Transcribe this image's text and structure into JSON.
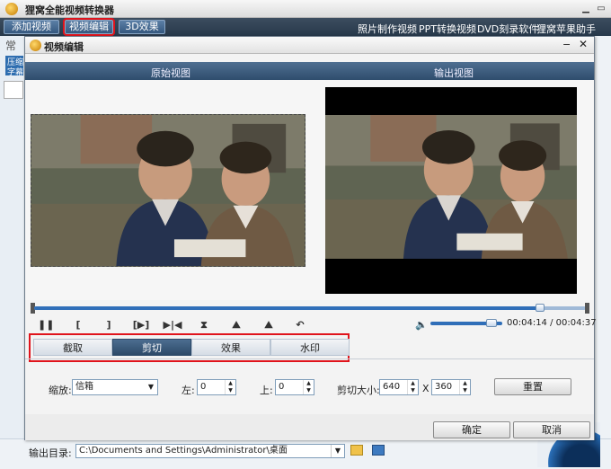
{
  "app": {
    "title": "狸窝全能视频转换器",
    "toolbar": {
      "add_video": "添加视频",
      "video_edit": "视频编辑",
      "effect_3d": "3D效果"
    },
    "links": [
      "照片制作视频",
      "PPT转换视频",
      "DVD刻录软件",
      "狸窝苹果助手"
    ],
    "bg_tab": "常",
    "bg_text": [
      "压缩",
      "字幕"
    ],
    "output_label": "输出目录:",
    "output_path": "C:\\Documents and Settings\\Administrator\\桌面"
  },
  "dialog": {
    "title": "视频编辑",
    "min": "−",
    "close": "✕",
    "original_view": "原始视图",
    "output_view": "输出视图",
    "time_current": "00:04:14",
    "time_total": "00:04:37",
    "time_text": "00:04:14 / 00:04:37",
    "seek_fraction": 0.917,
    "volume_fraction": 0.85,
    "controls": [
      "❚❚",
      "[",
      "]",
      "[▶]",
      "▶|◀",
      "⧗",
      "⛰",
      "⛰",
      "↶"
    ],
    "tabs": [
      "截取",
      "剪切",
      "效果",
      "水印"
    ],
    "active_tab": 1,
    "zoom_label": "缩放:",
    "zoom_value": "信箱",
    "left_label": "左:",
    "left_value": "0",
    "top_label": "上:",
    "top_value": "0",
    "crop_size_label": "剪切大小:",
    "crop_width": "640",
    "crop_x": "X",
    "crop_height": "360",
    "reset_label": "重置",
    "ok_label": "确定",
    "cancel_label": "取消"
  },
  "colors": {
    "toolbar_bg": "#2f4155",
    "header_bg": "#3f5f80",
    "highlight": "#e0141c",
    "accent": "#2f6eb8"
  }
}
